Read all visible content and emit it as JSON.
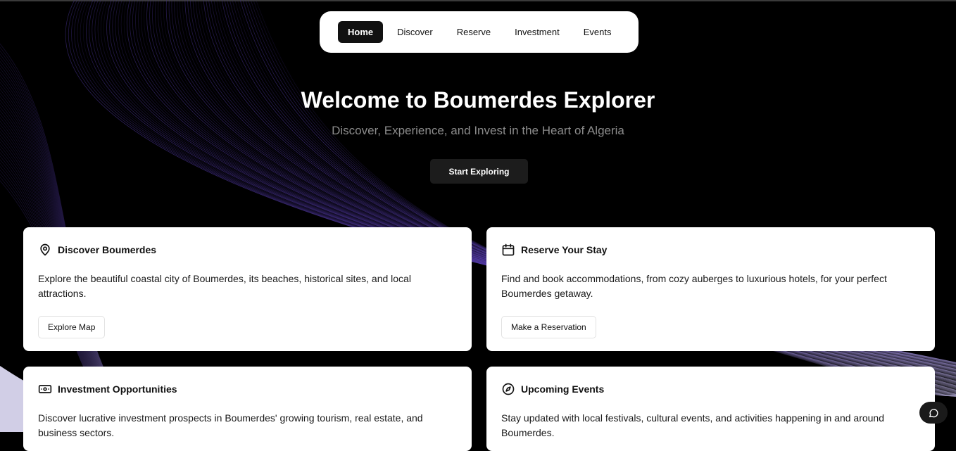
{
  "nav": {
    "items": [
      {
        "label": "Home",
        "active": true
      },
      {
        "label": "Discover",
        "active": false
      },
      {
        "label": "Reserve",
        "active": false
      },
      {
        "label": "Investment",
        "active": false
      },
      {
        "label": "Events",
        "active": false
      }
    ]
  },
  "hero": {
    "title": "Welcome to Boumerdes Explorer",
    "subtitle": "Discover, Experience, and Invest in the Heart of Algeria",
    "cta_label": "Start Exploring"
  },
  "cards": [
    {
      "icon": "map-pin-icon",
      "title": "Discover Boumerdes",
      "description": "Explore the beautiful coastal city of Boumerdes, its beaches, historical sites, and local attractions.",
      "button_label": "Explore Map"
    },
    {
      "icon": "calendar-icon",
      "title": "Reserve Your Stay",
      "description": "Find and book accommodations, from cozy auberges to luxurious hotels, for your perfect Boumerdes getaway.",
      "button_label": "Make a Reservation"
    },
    {
      "icon": "banknote-icon",
      "title": "Investment Opportunities",
      "description": "Discover lucrative investment prospects in Boumerdes' growing tourism, real estate, and business sectors.",
      "button_label": ""
    },
    {
      "icon": "compass-icon",
      "title": "Upcoming Events",
      "description": "Stay updated with local festivals, cultural events, and activities happening in and around Boumerdes.",
      "button_label": ""
    }
  ],
  "chat": {
    "icon": "chat-bubble-icon"
  },
  "colors": {
    "background": "#000000",
    "accent_purple": "#6b4bd6",
    "card": "#ffffff",
    "button_dark": "#1c1c1c"
  }
}
